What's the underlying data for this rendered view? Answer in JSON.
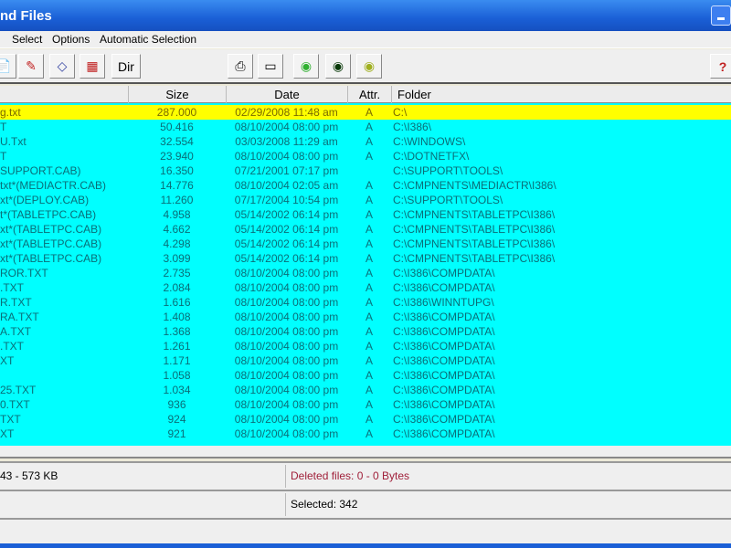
{
  "window": {
    "title": "nd Files"
  },
  "menu": [
    "Select",
    "Options",
    "Automatic Selection"
  ],
  "toolbar": {
    "dir_label": "Dir",
    "help_label": "?"
  },
  "columns": {
    "name": "",
    "size": "Size",
    "date": "Date",
    "attr": "Attr.",
    "folder": "Folder"
  },
  "rows": [
    {
      "name": "g.txt",
      "size": "287.000",
      "date": "02/29/2008 11:48 am",
      "attr": "A",
      "folder": "C:\\",
      "selected": true
    },
    {
      "name": "T",
      "size": "50.416",
      "date": "08/10/2004 08:00 pm",
      "attr": "A",
      "folder": "C:\\I386\\"
    },
    {
      "name": "U.Txt",
      "size": "32.554",
      "date": "03/03/2008 11:29 am",
      "attr": "A",
      "folder": "C:\\WINDOWS\\"
    },
    {
      "name": "T",
      "size": "23.940",
      "date": "08/10/2004 08:00 pm",
      "attr": "A",
      "folder": "C:\\DOTNETFX\\"
    },
    {
      "name": "SUPPORT.CAB)",
      "size": "16.350",
      "date": "07/21/2001 07:17 pm",
      "attr": "",
      "folder": "C:\\SUPPORT\\TOOLS\\"
    },
    {
      "name": "txt*(MEDIACTR.CAB)",
      "size": "14.776",
      "date": "08/10/2004 02:05 am",
      "attr": "A",
      "folder": "C:\\CMPNENTS\\MEDIACTR\\I386\\"
    },
    {
      "name": "xt*(DEPLOY.CAB)",
      "size": "11.260",
      "date": "07/17/2004 10:54 pm",
      "attr": "A",
      "folder": "C:\\SUPPORT\\TOOLS\\"
    },
    {
      "name": "t*(TABLETPC.CAB)",
      "size": "4.958",
      "date": "05/14/2002 06:14 pm",
      "attr": "A",
      "folder": "C:\\CMPNENTS\\TABLETPC\\I386\\"
    },
    {
      "name": "xt*(TABLETPC.CAB)",
      "size": "4.662",
      "date": "05/14/2002 06:14 pm",
      "attr": "A",
      "folder": "C:\\CMPNENTS\\TABLETPC\\I386\\"
    },
    {
      "name": "xt*(TABLETPC.CAB)",
      "size": "4.298",
      "date": "05/14/2002 06:14 pm",
      "attr": "A",
      "folder": "C:\\CMPNENTS\\TABLETPC\\I386\\"
    },
    {
      "name": "xt*(TABLETPC.CAB)",
      "size": "3.099",
      "date": "05/14/2002 06:14 pm",
      "attr": "A",
      "folder": "C:\\CMPNENTS\\TABLETPC\\I386\\"
    },
    {
      "name": "ROR.TXT",
      "size": "2.735",
      "date": "08/10/2004 08:00 pm",
      "attr": "A",
      "folder": "C:\\I386\\COMPDATA\\"
    },
    {
      "name": ".TXT",
      "size": "2.084",
      "date": "08/10/2004 08:00 pm",
      "attr": "A",
      "folder": "C:\\I386\\COMPDATA\\"
    },
    {
      "name": "R.TXT",
      "size": "1.616",
      "date": "08/10/2004 08:00 pm",
      "attr": "A",
      "folder": "C:\\I386\\WINNTUPG\\"
    },
    {
      "name": "RA.TXT",
      "size": "1.408",
      "date": "08/10/2004 08:00 pm",
      "attr": "A",
      "folder": "C:\\I386\\COMPDATA\\"
    },
    {
      "name": "A.TXT",
      "size": "1.368",
      "date": "08/10/2004 08:00 pm",
      "attr": "A",
      "folder": "C:\\I386\\COMPDATA\\"
    },
    {
      "name": ".TXT",
      "size": "1.261",
      "date": "08/10/2004 08:00 pm",
      "attr": "A",
      "folder": "C:\\I386\\COMPDATA\\"
    },
    {
      "name": "XT",
      "size": "1.171",
      "date": "08/10/2004 08:00 pm",
      "attr": "A",
      "folder": "C:\\I386\\COMPDATA\\"
    },
    {
      "name": "",
      "size": "1.058",
      "date": "08/10/2004 08:00 pm",
      "attr": "A",
      "folder": "C:\\I386\\COMPDATA\\"
    },
    {
      "name": "25.TXT",
      "size": "1.034",
      "date": "08/10/2004 08:00 pm",
      "attr": "A",
      "folder": "C:\\I386\\COMPDATA\\"
    },
    {
      "name": "0.TXT",
      "size": "936",
      "date": "08/10/2004 08:00 pm",
      "attr": "A",
      "folder": "C:\\I386\\COMPDATA\\"
    },
    {
      "name": "TXT",
      "size": "924",
      "date": "08/10/2004 08:00 pm",
      "attr": "A",
      "folder": "C:\\I386\\COMPDATA\\"
    },
    {
      "name": "XT",
      "size": "921",
      "date": "08/10/2004 08:00 pm",
      "attr": "A",
      "folder": "C:\\I386\\COMPDATA\\"
    }
  ],
  "status": {
    "total": "43 -  573 KB",
    "deleted": "Deleted files: 0 - 0 Bytes",
    "selected": "Selected: 342"
  },
  "colors": {
    "row_bg": "#00ffff",
    "selected_bg": "#ffff00",
    "deleted_text": "#a0203a",
    "title_bar": "#1a5fd6"
  }
}
